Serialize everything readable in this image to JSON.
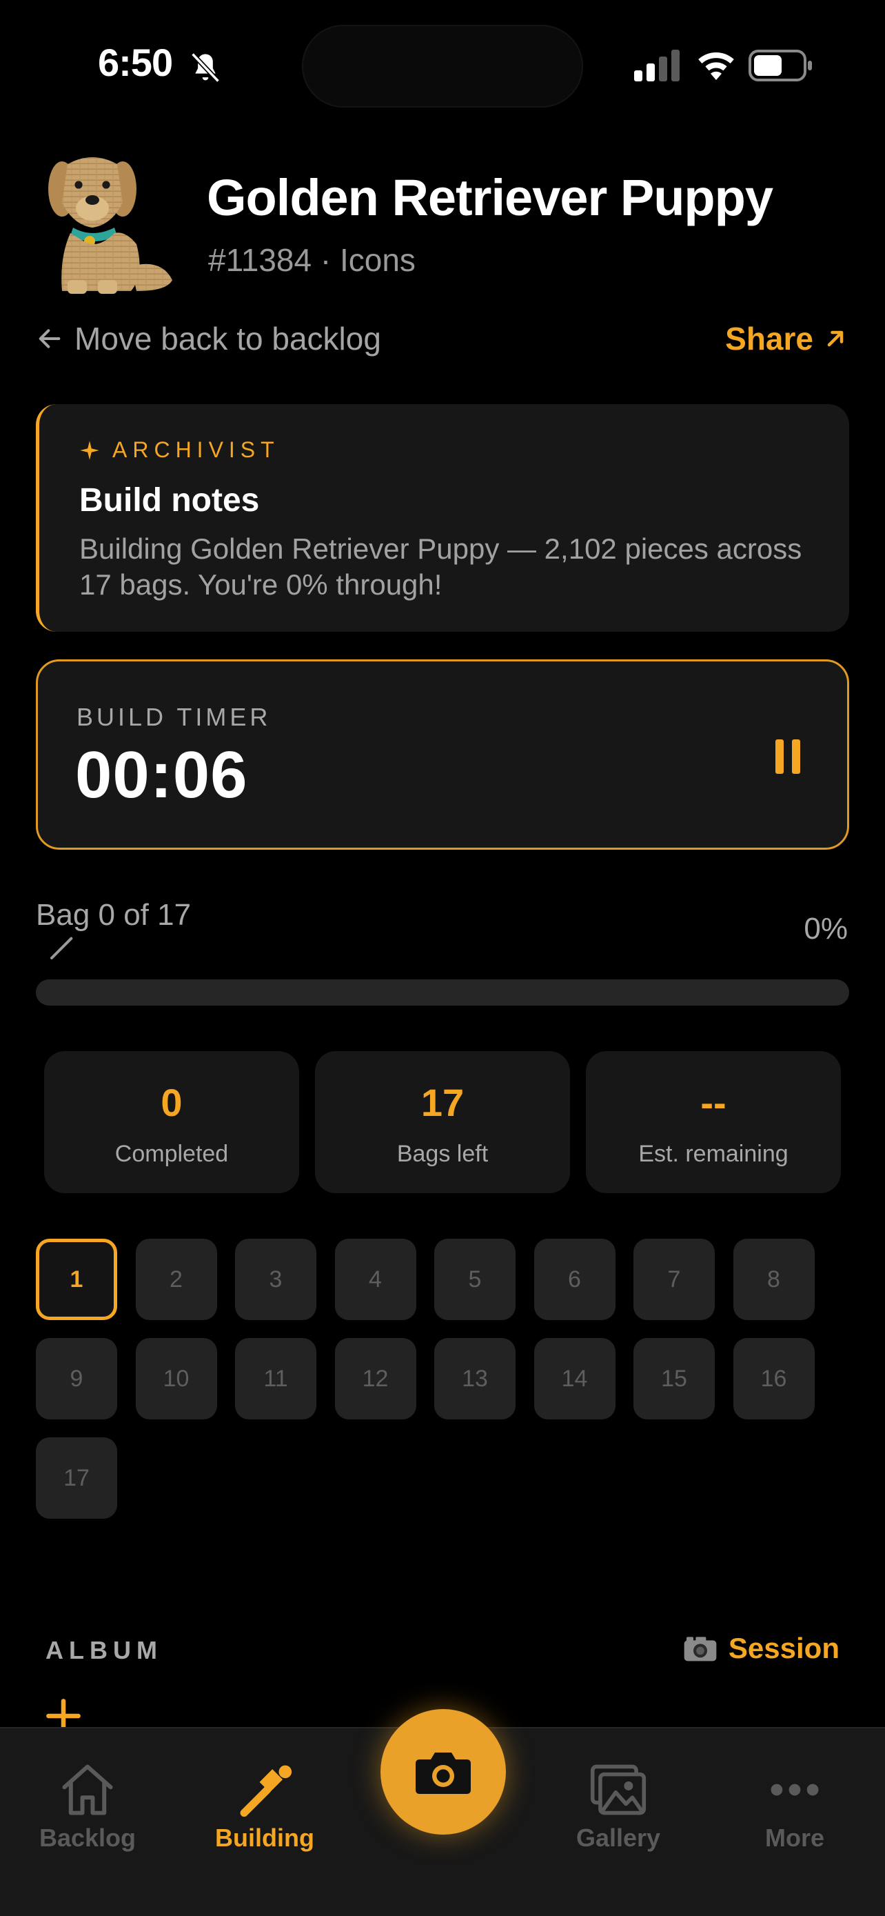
{
  "status_bar": {
    "time": "6:50"
  },
  "set": {
    "title": "Golden Retriever Puppy",
    "meta": "#11384 · Icons"
  },
  "nav": {
    "back_label": "Move back to backlog",
    "share_label": "Share"
  },
  "notes": {
    "tag": "ARCHIVIST",
    "title": "Build notes",
    "body": "Building Golden Retriever Puppy — 2,102 pieces across 17 bags. You're 0% through!"
  },
  "timer": {
    "label": "BUILD TIMER",
    "value": "00:06"
  },
  "progress": {
    "bag_label": "Bag 0 of 17",
    "percent_label": "0%",
    "fraction": 0
  },
  "stats": [
    {
      "value": "0",
      "label": "Completed"
    },
    {
      "value": "17",
      "label": "Bags left"
    },
    {
      "value": "--",
      "label": "Est. remaining"
    }
  ],
  "bags": [
    "1",
    "2",
    "3",
    "4",
    "5",
    "6",
    "7",
    "8",
    "9",
    "10",
    "11",
    "12",
    "13",
    "14",
    "15",
    "16",
    "17"
  ],
  "active_bag": "1",
  "album": {
    "title": "ALBUM",
    "session_label": "Session"
  },
  "tabs": [
    {
      "label": "Backlog",
      "icon": "home-icon"
    },
    {
      "label": "Building",
      "icon": "hammer-icon"
    },
    {
      "label": "Gallery",
      "icon": "gallery-icon"
    },
    {
      "label": "More",
      "icon": "more-icon"
    }
  ],
  "colors": {
    "accent": "#F5A623",
    "background": "#000000",
    "card": "#171717"
  }
}
